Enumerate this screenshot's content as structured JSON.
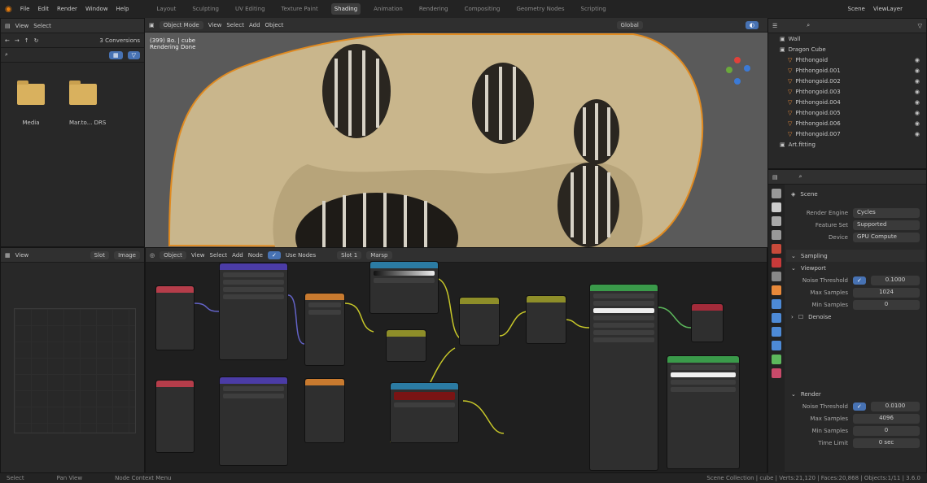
{
  "menu": [
    "File",
    "Edit",
    "Render",
    "Window",
    "Help"
  ],
  "workspaces": [
    "Layout",
    "Sculpting",
    "UV Editing",
    "Texture Paint",
    "Shading",
    "Animation",
    "Rendering",
    "Compositing",
    "Geometry Nodes",
    "Scripting"
  ],
  "active_workspace": "Shading",
  "scene_label": "Scene",
  "view_layer_label": "ViewLayer",
  "file_browser": {
    "menu": [
      "View",
      "Select"
    ],
    "path_label": "3 Conversions",
    "folders": [
      "Media",
      "Mar.to... DRS"
    ]
  },
  "viewport": {
    "mode": "Object Mode",
    "menu": [
      "View",
      "Select",
      "Add",
      "Object"
    ],
    "info_line1": "(399) Bo. | cube",
    "info_line2": "Rendering Done",
    "shading_mode": "Global"
  },
  "outliner": {
    "collections": [
      {
        "name": "Wall"
      },
      {
        "name": "Dragon Cube"
      }
    ],
    "objects": [
      "Phthongoid",
      "Phthongoid.001",
      "Phthongoid.002",
      "Phthongoid.003",
      "Phthongoid.004",
      "Phthongoid.005",
      "Phthongoid.006",
      "Phthongoid.007"
    ],
    "last": "Art.fitting"
  },
  "properties": {
    "scene": "Scene",
    "render_engine_label": "Render Engine",
    "render_engine": "Cycles",
    "feature_set_label": "Feature Set",
    "feature_set": "Supported",
    "device_label": "Device",
    "device": "GPU Compute",
    "sampling": "Sampling",
    "viewport_sub": "Viewport",
    "noise_threshold_label": "Noise Threshold",
    "noise_threshold_vp": "0.1000",
    "max_samples_label": "Max Samples",
    "max_samples_vp": "1024",
    "min_samples_label": "Min Samples",
    "min_samples_vp": "0",
    "denoise": "Denoise",
    "render_sub": "Render",
    "noise_threshold_r": "0.0100",
    "max_samples_r": "4096",
    "min_samples_r": "0",
    "time_limit_label": "Time Limit",
    "time_limit": "0 sec"
  },
  "shader_editor": {
    "object_label": "Object",
    "menu": [
      "View",
      "Select",
      "Add",
      "Node"
    ],
    "use_nodes": "Use Nodes",
    "slot": "Slot 1",
    "material": "Marsp"
  },
  "bottom_left": {
    "view": "View",
    "buttons": [
      "Slot",
      "Image"
    ]
  },
  "statusbar": {
    "left": "Select",
    "mid": "Pan View",
    "mid2": "Node Context Menu",
    "right": "Scene Collection | cube | Verts:21,120 | Faces:20,868 | Objects:1/11 | 3.6.0"
  }
}
